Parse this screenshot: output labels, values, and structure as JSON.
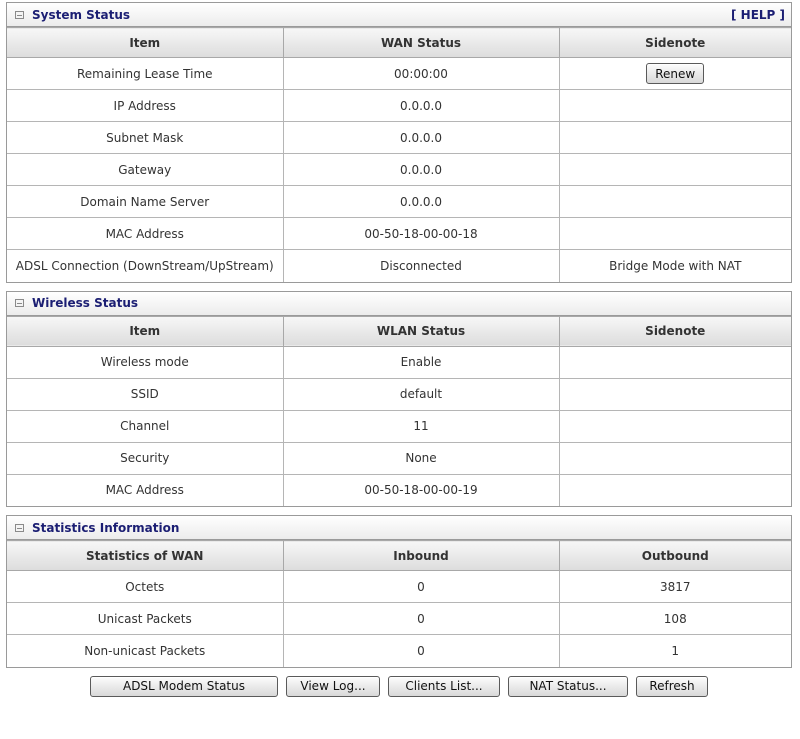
{
  "system": {
    "title": "System Status",
    "help": "[ HELP ]",
    "headers": [
      "Item",
      "WAN Status",
      "Sidenote"
    ],
    "rows": [
      {
        "item": "Remaining Lease Time",
        "status": "00:00:00",
        "note": ""
      },
      {
        "item": "IP Address",
        "status": "0.0.0.0",
        "note": ""
      },
      {
        "item": "Subnet Mask",
        "status": "0.0.0.0",
        "note": ""
      },
      {
        "item": "Gateway",
        "status": "0.0.0.0",
        "note": ""
      },
      {
        "item": "Domain Name Server",
        "status": "0.0.0.0",
        "note": ""
      },
      {
        "item": "MAC Address",
        "status": "00-50-18-00-00-18",
        "note": ""
      },
      {
        "item": "ADSL Connection (DownStream/UpStream)",
        "status": "Disconnected",
        "note": "Bridge Mode with NAT"
      }
    ],
    "renew_label": "Renew"
  },
  "wireless": {
    "title": "Wireless Status",
    "headers": [
      "Item",
      "WLAN Status",
      "Sidenote"
    ],
    "rows": [
      {
        "item": "Wireless mode",
        "status": "Enable",
        "note": ""
      },
      {
        "item": "SSID",
        "status": "default",
        "note": ""
      },
      {
        "item": "Channel",
        "status": "11",
        "note": ""
      },
      {
        "item": "Security",
        "status": "None",
        "note": ""
      },
      {
        "item": "MAC Address",
        "status": "00-50-18-00-00-19",
        "note": ""
      }
    ]
  },
  "statistics": {
    "title": "Statistics Information",
    "headers": [
      "Statistics of WAN",
      "Inbound",
      "Outbound"
    ],
    "rows": [
      {
        "item": "Octets",
        "inbound": "0",
        "outbound": "3817"
      },
      {
        "item": "Unicast Packets",
        "inbound": "0",
        "outbound": "108"
      },
      {
        "item": "Non-unicast Packets",
        "inbound": "0",
        "outbound": "1"
      }
    ]
  },
  "buttons": {
    "adsl_modem_status": "ADSL Modem Status",
    "view_log": "View Log...",
    "clients_list": "Clients List...",
    "nat_status": "NAT Status...",
    "refresh": "Refresh"
  },
  "icons": {
    "panel": "collapse-box-icon"
  },
  "colors": {
    "title_text": "#1b1e73",
    "border": "#9a9a9a"
  }
}
